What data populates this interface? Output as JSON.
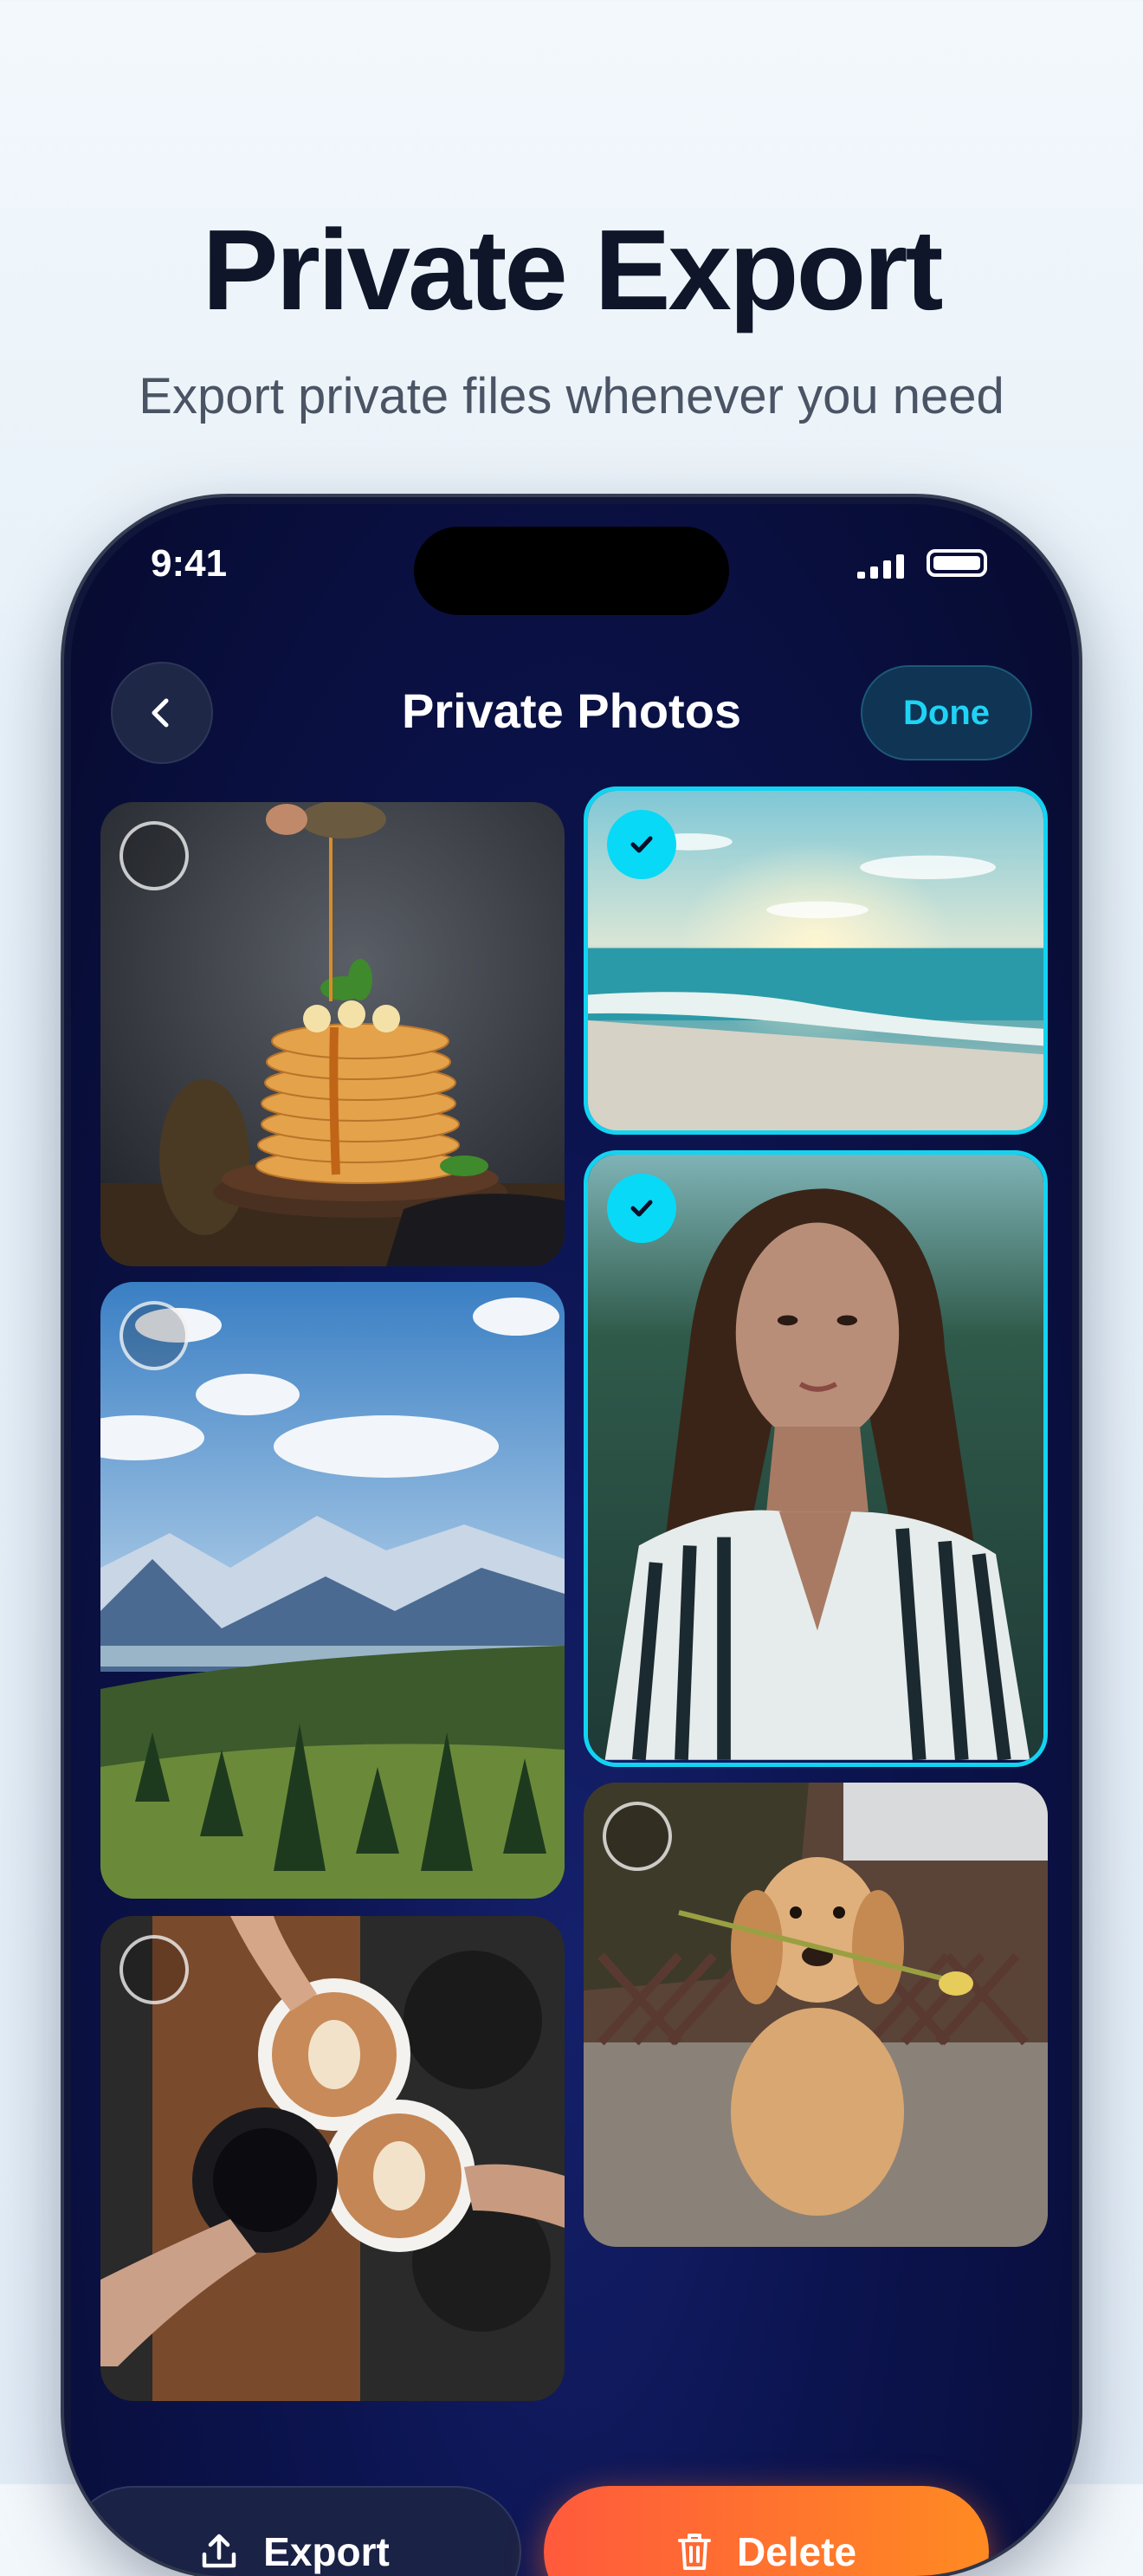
{
  "hero": {
    "title": "Private Export",
    "subtitle": "Export private files whenever you need"
  },
  "status_bar": {
    "time": "9:41",
    "icons": [
      "signal-icon",
      "battery-icon"
    ]
  },
  "nav": {
    "back_icon": "chevron-left-icon",
    "title": "Private Photos",
    "done_label": "Done"
  },
  "photos": [
    {
      "subject": "pancakes",
      "selected": false
    },
    {
      "subject": "beach",
      "selected": true
    },
    {
      "subject": "portrait",
      "selected": true
    },
    {
      "subject": "mountains",
      "selected": false
    },
    {
      "subject": "dog",
      "selected": false
    },
    {
      "subject": "coffee",
      "selected": false
    }
  ],
  "actions": {
    "export_label": "Export",
    "export_icon": "upload-icon",
    "delete_label": "Delete",
    "delete_icon": "trash-icon"
  },
  "colors": {
    "accent": "#12d4f2",
    "delete_start": "#ff5a3c",
    "delete_end": "#ff8a22",
    "screen_bg": "#0c1450"
  }
}
